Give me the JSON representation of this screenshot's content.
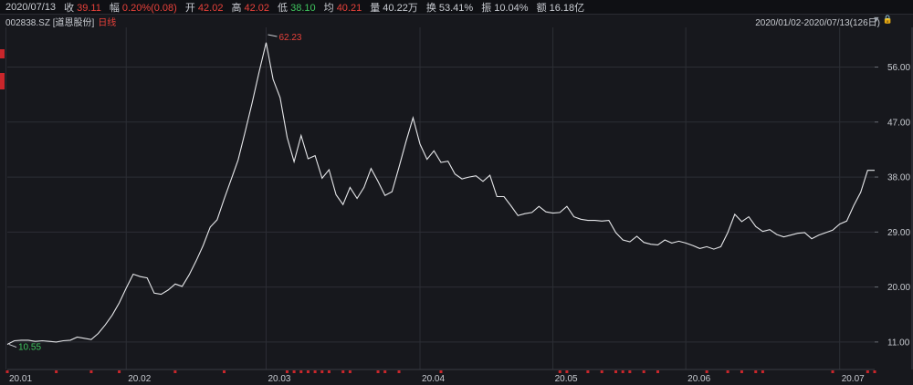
{
  "header": {
    "date": "2020/07/13",
    "close_label": "收",
    "close_value": "39.11",
    "change_label": "幅",
    "change_value": "0.20%(0.08)",
    "open_label": "开",
    "open_value": "42.02",
    "high_label": "高",
    "high_value": "42.02",
    "low_label": "低",
    "low_value": "38.10",
    "avg_label": "均",
    "avg_value": "40.21",
    "volume_label": "量",
    "volume_value": "40.22万",
    "turnover_label": "换",
    "turnover_value": "53.41%",
    "amplitude_label": "振",
    "amplitude_value": "10.04%",
    "amount_label": "额",
    "amount_value": "16.18亿"
  },
  "subheader": {
    "code": "002838.SZ [道恩股份]",
    "period": "日线",
    "range": "2020/01/02-2020/07/13(126日)"
  },
  "colors": {
    "background": "#17181d",
    "line": "#e6e7ea",
    "grid": "#2c2e35",
    "up_red": "#e8413a",
    "down_green": "#3fc45e",
    "marker": "#c9262b"
  },
  "chart_data": {
    "type": "line",
    "x_tick_labels": [
      "20.01",
      "20.02",
      "20.03",
      "20.04",
      "20.05",
      "20.06",
      "20.07"
    ],
    "y_ticks": [
      "11.00",
      "20.00",
      "29.00",
      "38.00",
      "47.00",
      "56.00"
    ],
    "ylim": [
      6.5,
      62.5
    ],
    "grid": true,
    "annotations": {
      "high": "62.23",
      "low": "10.55"
    },
    "series": [
      {
        "values": [
          10.6,
          11.2,
          11.3,
          11.3,
          11.1,
          11.2,
          11.1,
          11.0,
          11.2,
          11.3,
          11.8,
          11.6,
          11.4,
          12.4,
          13.8,
          15.4,
          17.4,
          19.8,
          22.1,
          21.7,
          21.5,
          19.0,
          18.8,
          19.5,
          20.5,
          20.1,
          22.0,
          24.3,
          26.8,
          29.8,
          31.0,
          34.4,
          37.6,
          40.8,
          45.4,
          50.1,
          55.2,
          60.0,
          54.0,
          51.0,
          44.5,
          40.5,
          44.8,
          41.0,
          41.5,
          37.8,
          39.2,
          35.1,
          33.5,
          36.3,
          34.5,
          36.3,
          39.4,
          37.3,
          35.0,
          35.6,
          39.6,
          43.8,
          47.7,
          43.4,
          40.9,
          42.3,
          40.4,
          40.6,
          38.5,
          37.7,
          38.0,
          38.2,
          37.3,
          38.3,
          34.8,
          34.8,
          33.3,
          31.7,
          32.0,
          32.2,
          33.2,
          32.3,
          32.1,
          32.2,
          33.2,
          31.5,
          31.1,
          30.9,
          30.9,
          30.8,
          30.9,
          28.9,
          27.7,
          27.4,
          28.3,
          27.3,
          27.0,
          26.9,
          27.7,
          27.2,
          27.5,
          27.2,
          26.8,
          26.3,
          26.6,
          26.2,
          26.6,
          28.9,
          31.9,
          30.7,
          31.5,
          29.9,
          29.1,
          29.4,
          28.6,
          28.2,
          28.5,
          28.8,
          28.9,
          27.9,
          28.5,
          28.9,
          29.3,
          30.3,
          30.8,
          33.3,
          35.5,
          39.1,
          39.1
        ]
      }
    ]
  }
}
